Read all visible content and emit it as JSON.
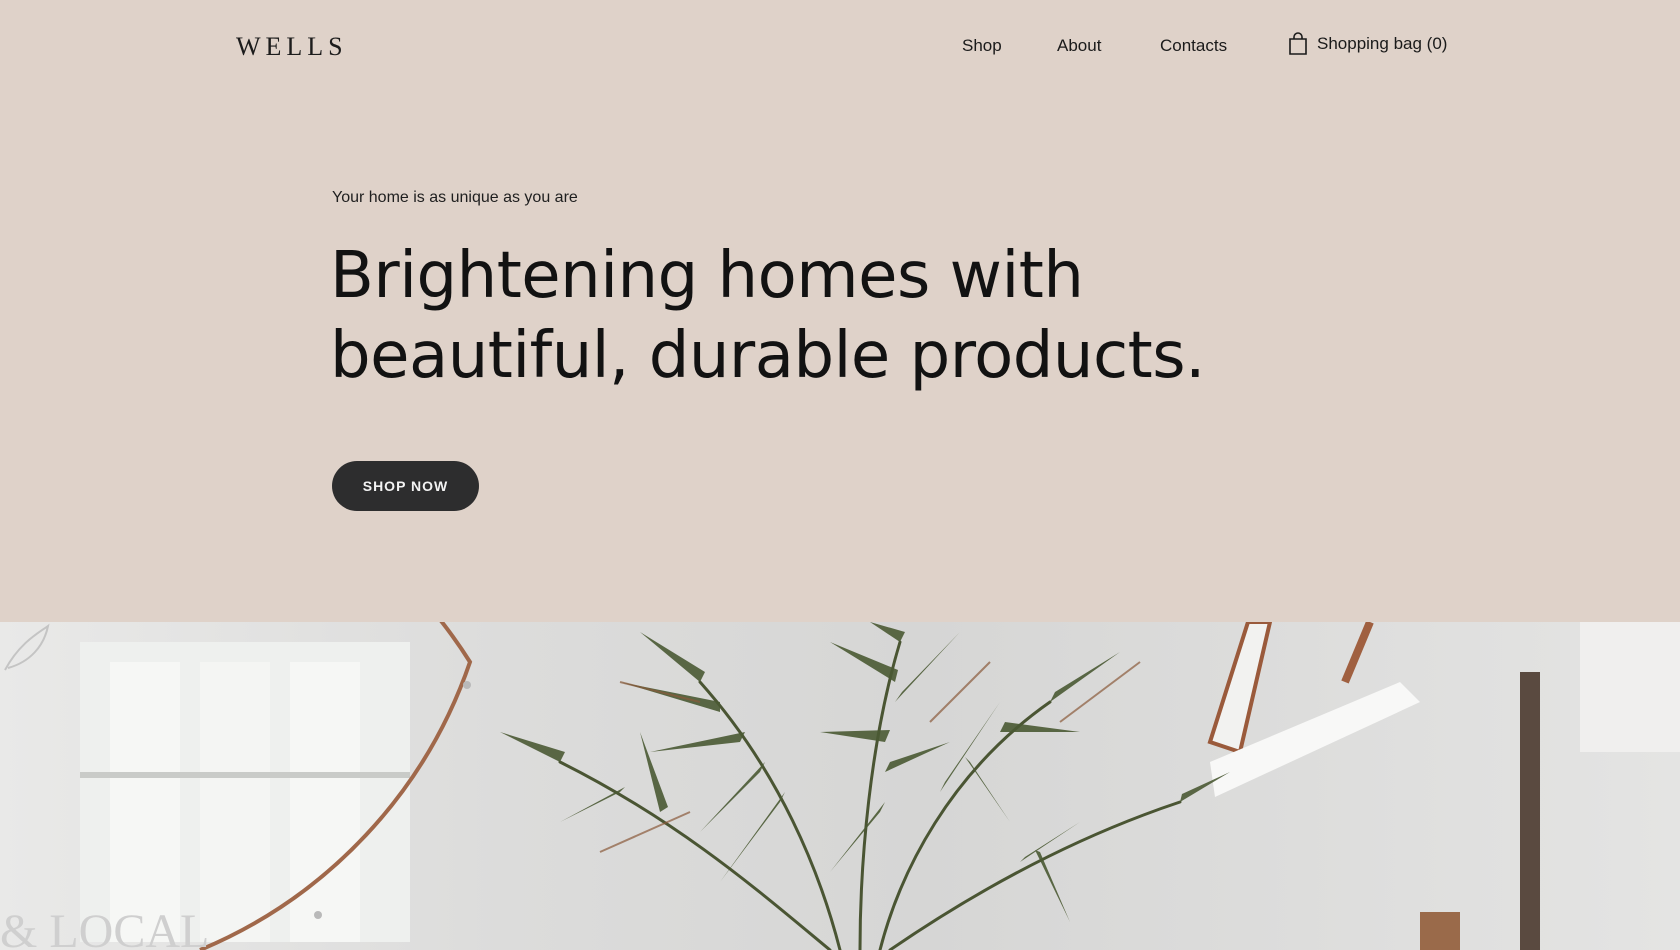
{
  "header": {
    "logo": "WELLS",
    "nav": [
      {
        "label": "Shop"
      },
      {
        "label": "About"
      },
      {
        "label": "Contacts"
      }
    ],
    "bag": {
      "label": "Shopping bag (0)",
      "icon": "shopping-bag-icon"
    }
  },
  "hero": {
    "tagline": "Your home is as unique as you are",
    "headline_line1": "Brightening homes with",
    "headline_line2": "beautiful, durable products.",
    "cta_label": "SHOP NOW"
  },
  "colors": {
    "background": "#dfd2c9",
    "button": "#2d2d2e",
    "text": "#141414"
  }
}
